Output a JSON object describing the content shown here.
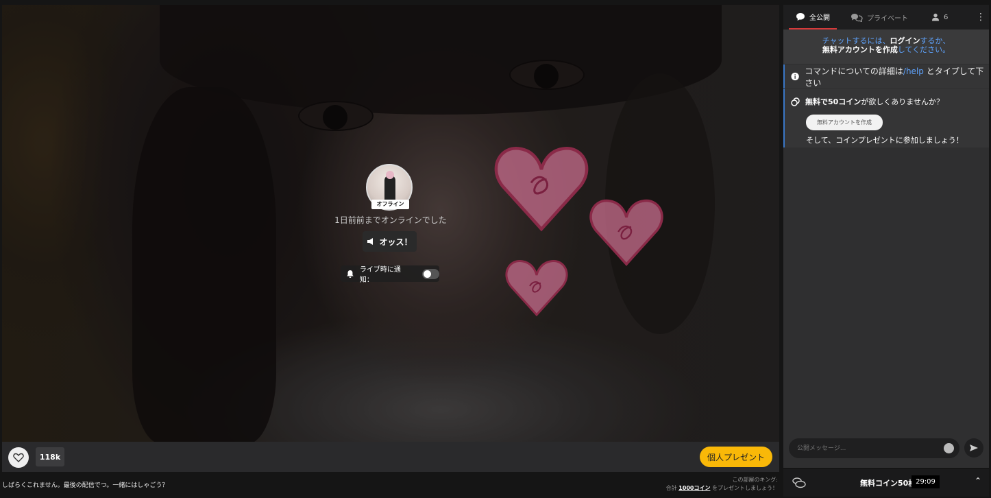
{
  "stream": {
    "status_badge": "オフライン",
    "last_online": "1日前前までオンラインでした",
    "oss_button": "オッス！",
    "notify_label": "ライブ時に通知：",
    "notify_on": false,
    "like_count": "118k",
    "gift_button": "個人プレゼント",
    "caption": "しばらくこれません。最後の配信でつ。一緒にはしゃごう？",
    "king_line1": "この部屋のキング:",
    "king_line2_pre": "合計",
    "king_line2_amount": "1000コイン",
    "king_line2_post": "をプレゼントしましょう！"
  },
  "chat": {
    "tabs": [
      {
        "label": "全公開",
        "icon": "chat-bubble-icon",
        "active": true
      },
      {
        "label": "プライベート",
        "icon": "private-chat-icon",
        "active": false
      },
      {
        "label": "6",
        "icon": "user-icon",
        "active": false
      }
    ],
    "login_prompt": {
      "pre": "チャットするには、",
      "login": "ログイン",
      "mid": "するか、",
      "create": "無料アカウントを作成",
      "post": "してください。"
    },
    "help_msg": {
      "pre": "コマンドについての詳細は",
      "cmd": "/help",
      "post": " とタイプして下さい"
    },
    "coin_msg": {
      "bold": "無料で50コイン",
      "rest": "が欲しくありませんか？",
      "button": "無料アカウントを作成",
      "last": "そして、コインプレゼントに参加しましょう！"
    },
    "input_placeholder": "公開メッセージ...",
    "coin_bar_text": "無料コイン50枚で",
    "timer": "29:09"
  },
  "colors": {
    "accent": "#f9b808",
    "link": "#5fa4ff",
    "tab_underline": "#d63a3a"
  }
}
